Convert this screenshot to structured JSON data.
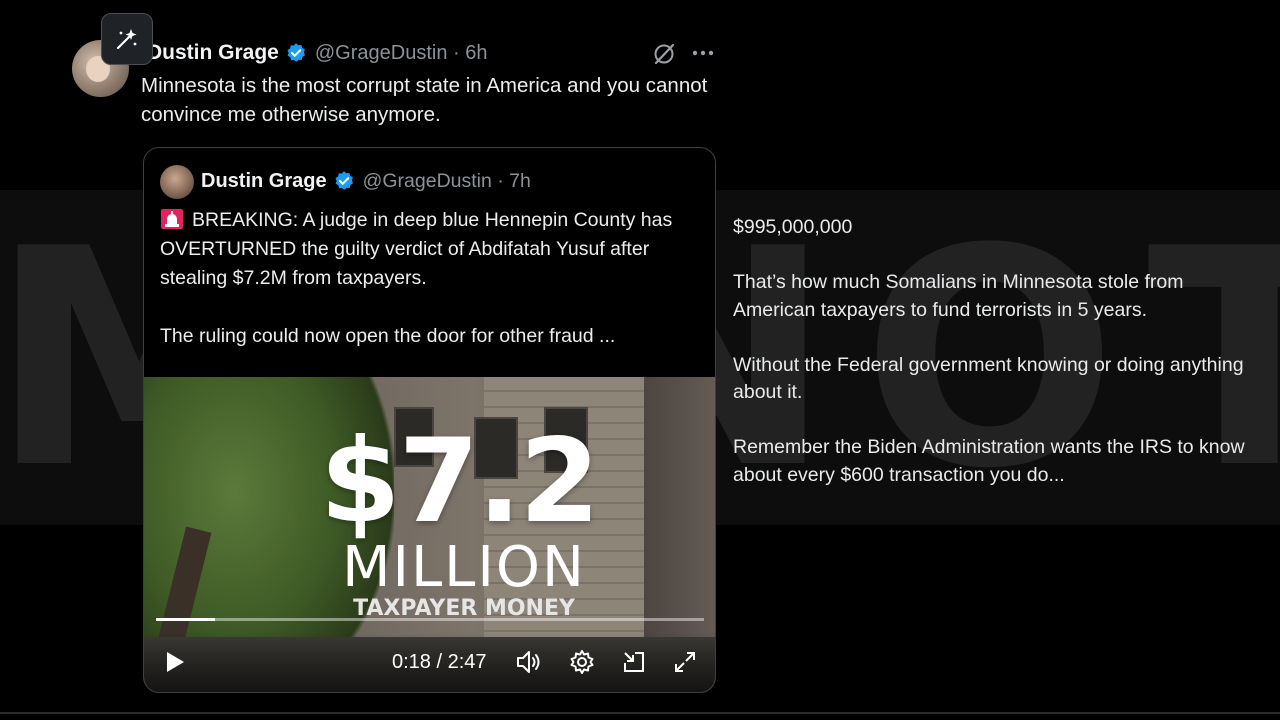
{
  "background": {
    "ghost_letters": "MKNOTM"
  },
  "tweet": {
    "author_name": "Dustin Grage",
    "handle_time": "@GrageDustin · 6h",
    "text": "Minnesota is the most corrupt state in America and you cannot convince me otherwise anymore."
  },
  "quote": {
    "author_name": "Dustin Grage",
    "handle_time": "@GrageDustin · 7h",
    "text": "BREAKING: A judge in deep blue Hennepin County has OVERTURNED the guilty verdict of Abdifatah Yusuf after stealing $7.2M from taxpayers.\n\nThe ruling could now open the door for other fraud ..."
  },
  "video": {
    "overlay_amount": "$7.2",
    "overlay_unit": "MILLION",
    "overlay_caption": "TAXPAYER MONEY",
    "current_time": "0:18",
    "duration": "2:47",
    "time_display": "0:18 / 2:47",
    "progress_fraction": 0.108
  },
  "side_text": {
    "p1": "$995,000,000",
    "p2": "That’s how much Somalians in Minnesota stole from American taxpayers to fund terrorists in 5 years.",
    "p3": "Without the Federal government knowing or doing anything about it.",
    "p4": "Remember the Biden Administration wants the IRS to know about every $600 transaction you do..."
  },
  "colors": {
    "verified": "#1d9bf0",
    "siren": "#e0245e",
    "muted_text": "#8b9298"
  },
  "icons": [
    "sparkle-icon",
    "verified-badge-icon",
    "grok-icon",
    "more-icon",
    "siren-icon",
    "play-icon",
    "volume-icon",
    "settings-icon",
    "pip-icon",
    "fullscreen-icon"
  ]
}
